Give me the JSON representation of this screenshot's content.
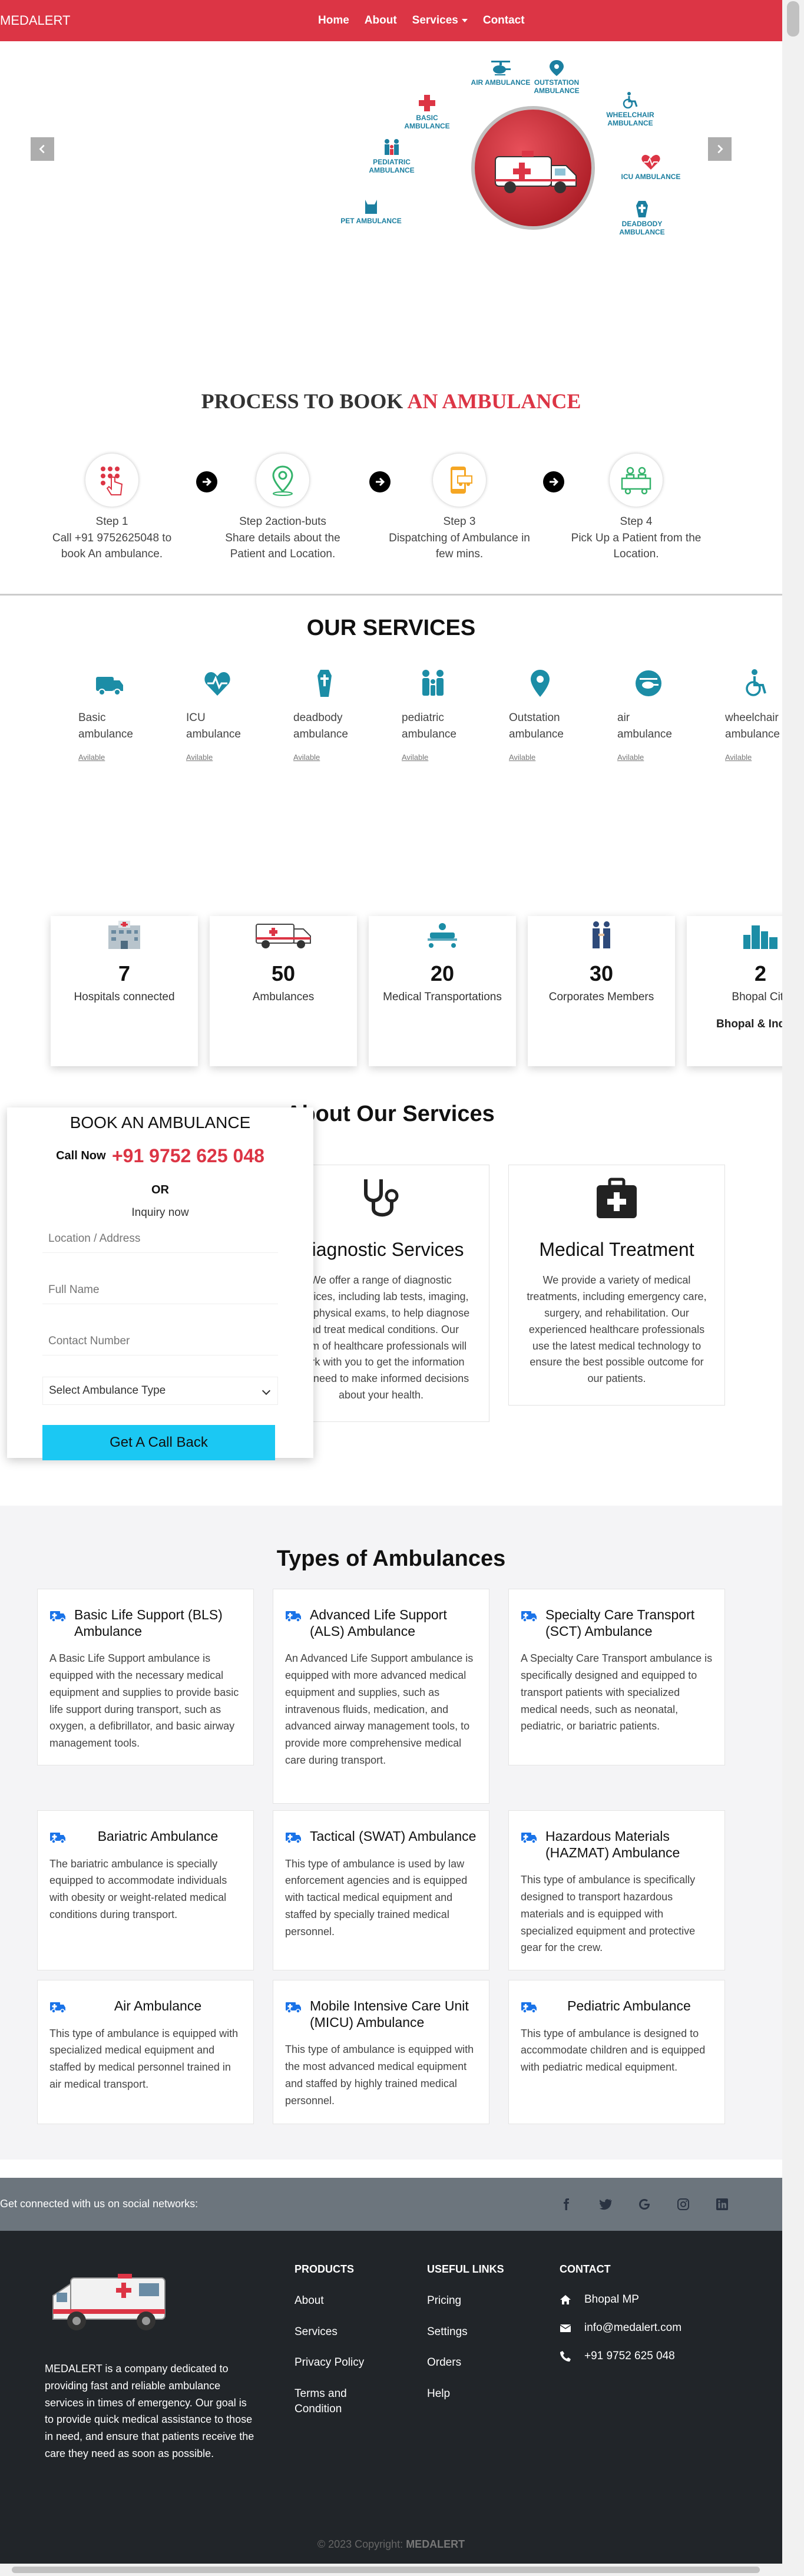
{
  "navbar": {
    "brand": "MEDALERT",
    "links": [
      "Home",
      "About",
      "Services",
      "Contact"
    ]
  },
  "hero": {
    "items": [
      {
        "label": "AIR AMBULANCE",
        "icon": "helicopter-icon"
      },
      {
        "label": "OUTSTATION AMBULANCE",
        "icon": "location-pin-icon"
      },
      {
        "label": "BASIC AMBULANCE",
        "icon": "medical-cross-icon"
      },
      {
        "label": "WHEELCHAIR AMBULANCE",
        "icon": "wheelchair-icon"
      },
      {
        "label": "PEDIATRIC AMBULANCE",
        "icon": "family-icon"
      },
      {
        "label": "ICU AMBULANCE",
        "icon": "heart-pulse-icon"
      },
      {
        "label": "PET AMBULANCE",
        "icon": "pet-icon"
      },
      {
        "label": "DEADBODY AMBULANCE",
        "icon": "coffin-icon"
      }
    ]
  },
  "process": {
    "title_plain": "PROCESS TO BOOK",
    "title_accent": "AN AMBULANCE",
    "steps": [
      {
        "title": "Step 1",
        "text": "Call +91 9752625048 to book An ambulance."
      },
      {
        "title": "Step 2action-buts",
        "text": "Share details about the Patient and Location."
      },
      {
        "title": "Step 3",
        "text": "Dispatching of Ambulance in few mins."
      },
      {
        "title": "Step 4",
        "text": "Pick Up a Patient from the Location."
      }
    ]
  },
  "services": {
    "title": "OUR SERVICES",
    "available_label": "Avilable",
    "items": [
      {
        "line1": "Basic",
        "line2": "ambulance",
        "icon": "ambulance-icon"
      },
      {
        "line1": "ICU",
        "line2": "ambulance",
        "icon": "heart-pulse-icon"
      },
      {
        "line1": "deadbody",
        "line2": "ambulance",
        "icon": "coffin-icon"
      },
      {
        "line1": "pediatric",
        "line2": "ambulance",
        "icon": "family-icon"
      },
      {
        "line1": "Outstation",
        "line2": "ambulance",
        "icon": "location-pin-icon"
      },
      {
        "line1": "air",
        "line2": "ambulance",
        "icon": "helicopter-icon"
      },
      {
        "line1": "wheelchair",
        "line2": "ambulance",
        "icon": "wheelchair-icon"
      }
    ]
  },
  "stats": [
    {
      "number": "7",
      "label": "Hospitals connected",
      "icon": "hospital-icon"
    },
    {
      "number": "50",
      "label": "Ambulances",
      "icon": "ambulance-icon"
    },
    {
      "number": "20",
      "label": "Medical Transportations",
      "icon": "stretcher-icon"
    },
    {
      "number": "30",
      "label": "Corporates Members",
      "icon": "handshake-icon"
    },
    {
      "number": "2",
      "label": "Bhopal City",
      "extra": "Bhopal & Indore",
      "icon": "city-icon"
    }
  ],
  "about": {
    "title": "About Our Services",
    "cards": [
      {
        "title": "Diagnostic Services",
        "text": "We offer a range of diagnostic services, including lab tests, imaging, and physical exams, to help diagnose and treat medical conditions. Our team of healthcare professionals will work with you to get the information you need to make informed decisions about your health.",
        "icon": "stethoscope-icon"
      },
      {
        "title": "Medical Treatment",
        "text": "We provide a variety of medical treatments, including emergency care, surgery, and rehabilitation. Our experienced healthcare professionals use the latest medical technology to ensure the best possible outcome for our patients.",
        "icon": "medical-kit-icon"
      }
    ]
  },
  "book": {
    "title": "BOOK AN AMBULANCE",
    "call_label": "Call Now",
    "call_number": "+91 9752 625 048",
    "or": "OR",
    "inquiry": "Inquiry now",
    "location_placeholder": "Location / Address",
    "name_placeholder": "Full Name",
    "contact_placeholder": "Contact Number",
    "select_value": "Select Ambulance Type",
    "button": "Get A Call Back"
  },
  "types": {
    "title": "Types of Ambulances",
    "cards": [
      {
        "name": "Basic Life Support (BLS) Ambulance",
        "desc": "A Basic Life Support ambulance is equipped with the necessary medical equipment and supplies to provide basic life support during transport, such as oxygen, a defibrillator, and basic airway management tools."
      },
      {
        "name": "Advanced Life Support (ALS) Ambulance",
        "desc": "An Advanced Life Support ambulance is equipped with more advanced medical equipment and supplies, such as intravenous fluids, medication, and advanced airway management tools, to provide more comprehensive medical care during transport."
      },
      {
        "name": "Specialty Care Transport (SCT) Ambulance",
        "desc": "A Specialty Care Transport ambulance is specifically designed and equipped to transport patients with specialized medical needs, such as neonatal, pediatric, or bariatric patients."
      },
      {
        "name": "Bariatric Ambulance",
        "desc": "The bariatric ambulance is specially equipped to accommodate individuals with obesity or weight-related medical conditions during transport."
      },
      {
        "name": "Tactical (SWAT) Ambulance",
        "desc": "This type of ambulance is used by law enforcement agencies and is equipped with tactical medical equipment and staffed by specially trained medical personnel."
      },
      {
        "name": "Hazardous Materials (HAZMAT) Ambulance",
        "desc": "This type of ambulance is specifically designed to transport hazardous materials and is equipped with specialized equipment and protective gear for the crew."
      },
      {
        "name": "Air Ambulance",
        "desc": "This type of ambulance is equipped with specialized medical equipment and staffed by medical personnel trained in air medical transport."
      },
      {
        "name": "Mobile Intensive Care Unit (MICU) Ambulance",
        "desc": "This type of ambulance is equipped with the most advanced medical equipment and staffed by highly trained medical personnel."
      },
      {
        "name": "Pediatric Ambulance",
        "desc": "This type of ambulance is designed to accommodate children and is equipped with pediatric medical equipment."
      }
    ]
  },
  "social": {
    "text": "Get connected with us on social networks:",
    "icons": [
      "facebook-icon",
      "twitter-icon",
      "google-icon",
      "instagram-icon",
      "linkedin-icon"
    ]
  },
  "footer": {
    "description": "MEDALERT is a company dedicated to providing fast and reliable ambulance services in times of emergency. Our goal is to provide quick medical assistance to those in need, and ensure that patients receive the care they need as soon as possible.",
    "products": {
      "heading": "PRODUCTS",
      "links": [
        "About",
        "Services",
        "Privacy Policy",
        "Terms and Condition"
      ]
    },
    "useful": {
      "heading": "USEFUL LINKS",
      "links": [
        "Pricing",
        "Settings",
        "Orders",
        "Help"
      ]
    },
    "contact": {
      "heading": "CONTACT",
      "address": "Bhopal MP",
      "email": "info@medalert.com",
      "phone": "+91 9752 625 048"
    },
    "copyright_prefix": "© 2023 Copyright:",
    "copyright_brand": "MEDALERT"
  },
  "colors": {
    "brand_red": "#dc3545",
    "teal": "#1c8da6",
    "cyan_button": "#1bc8f3",
    "footer_dark": "#212529"
  }
}
